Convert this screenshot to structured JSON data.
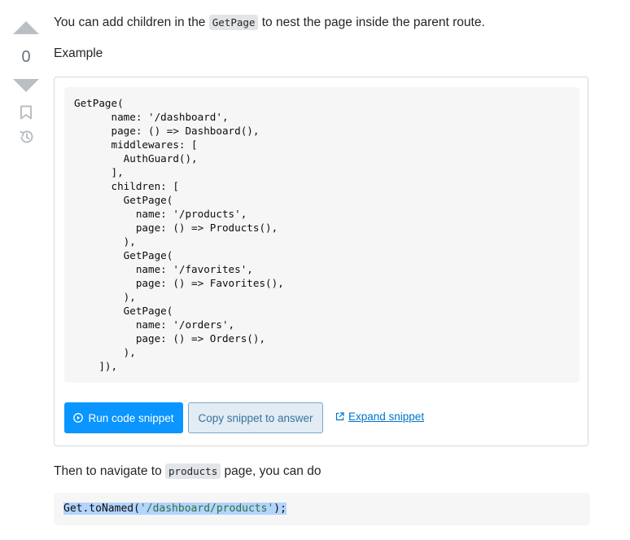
{
  "vote": {
    "count": "0"
  },
  "answer": {
    "p1": {
      "before": "You can add children in the ",
      "code": "GetPage",
      "after": " to nest the page inside the parent route."
    },
    "p2": "Example",
    "snippet": {
      "code": "GetPage(\n      name: '/dashboard',\n      page: () => Dashboard(),\n      middlewares: [\n        AuthGuard(),\n      ],\n      children: [\n        GetPage(\n          name: '/products',\n          page: () => Products(),\n        ),\n        GetPage(\n          name: '/favorites',\n          page: () => Favorites(),\n        ),\n        GetPage(\n          name: '/orders',\n          page: () => Orders(),\n        ),\n    ]),",
      "run_label": "Run code snippet",
      "copy_label": "Copy snippet to answer",
      "expand_label": "Expand snippet"
    },
    "p3": {
      "before": "Then to navigate to ",
      "code": "products",
      "after": " page, you can do"
    },
    "code_line": {
      "part1": "Get.toNamed(",
      "string": "'/dashboard/products'",
      "part2": ");"
    }
  },
  "colors": {
    "primary_button": "#0a95ff",
    "secondary_button": "#e1ecf4",
    "link": "#0074cc",
    "vote_arrow": "#babfc4",
    "selection": "#b3d4fc"
  },
  "icons": [
    "upvote-arrow-icon",
    "downvote-arrow-icon",
    "bookmark-icon",
    "history-icon",
    "play-circle-icon",
    "external-link-icon"
  ]
}
